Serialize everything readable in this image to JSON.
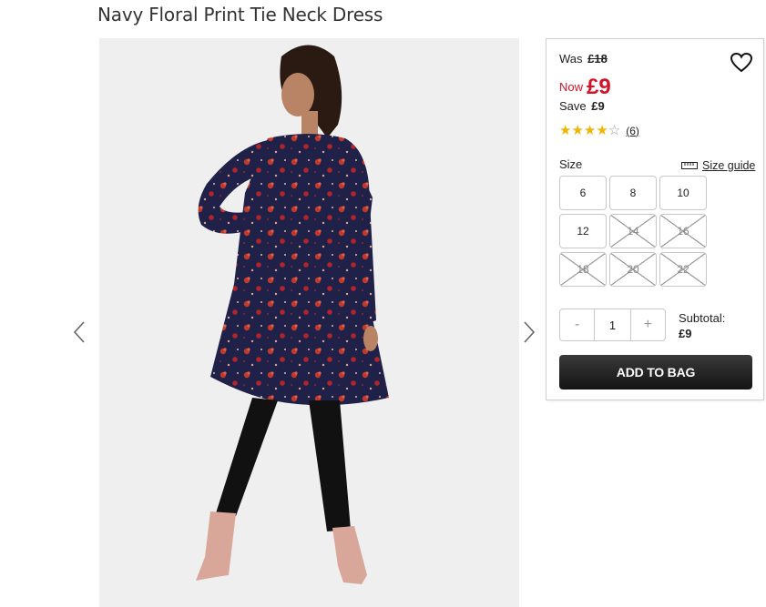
{
  "product": {
    "title": "Navy Floral Print Tie Neck Dress"
  },
  "pricing": {
    "was_label": "Was",
    "was_price": "£18",
    "now_label": "Now",
    "now_price": "£9",
    "save_label": "Save",
    "save_amount": "£9",
    "sale_color": "#d3132a"
  },
  "rating": {
    "stars": 4,
    "max": 5,
    "count": "(6)"
  },
  "size": {
    "label": "Size",
    "guide_label": "Size guide",
    "options": [
      {
        "label": "6",
        "available": true
      },
      {
        "label": "8",
        "available": true
      },
      {
        "label": "10",
        "available": true
      },
      {
        "label": "12",
        "available": true
      },
      {
        "label": "14",
        "available": false
      },
      {
        "label": "16",
        "available": false
      },
      {
        "label": "18",
        "available": false
      },
      {
        "label": "20",
        "available": false
      },
      {
        "label": "22",
        "available": false
      }
    ]
  },
  "quantity": {
    "minus": "-",
    "value": "1",
    "plus": "+"
  },
  "subtotal": {
    "label": "Subtotal:",
    "amount": "£9"
  },
  "cart": {
    "add_label": "ADD TO BAG"
  },
  "icons": {
    "prev": "chevron-left-icon",
    "next": "chevron-right-icon",
    "wishlist": "heart-icon",
    "size_guide": "ruler-icon"
  }
}
